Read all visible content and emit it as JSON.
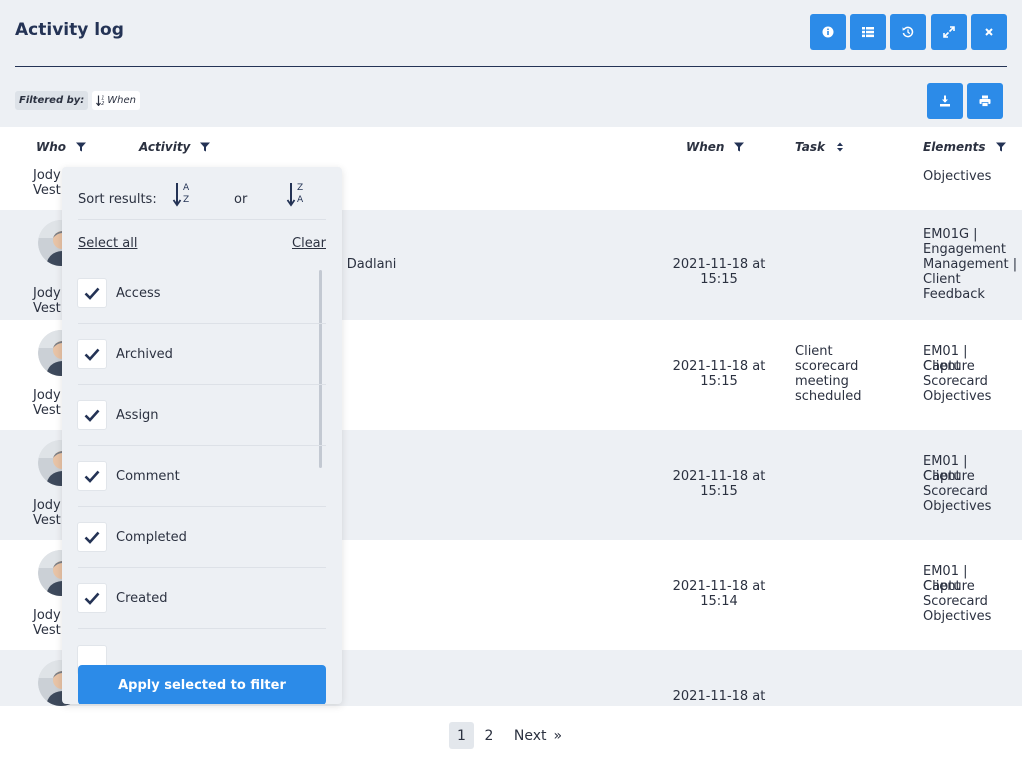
{
  "header": {
    "title": "Activity log",
    "toolbar_icons": [
      "info-icon",
      "list-icon",
      "history-icon",
      "expand-icon",
      "close-icon"
    ],
    "action_icons": [
      "download-icon",
      "print-icon"
    ]
  },
  "filter": {
    "label": "Filtered by:",
    "chip": "When"
  },
  "columns": {
    "who": "Who",
    "activity": "Activity",
    "when": "When",
    "task": "Task",
    "elements": "Elements"
  },
  "rows": [
    {
      "who1": "Jody",
      "who2": "Vest",
      "activity": "",
      "when1": "",
      "when2": "",
      "task": [],
      "elements": [
        "Objectives"
      ]
    },
    {
      "who1": "Jody",
      "who2": "Vest",
      "activity": "l Dadlani",
      "when1": "2021-11-18 at",
      "when2": "15:15",
      "task": [],
      "elements": [
        "EM01G |",
        "Engagement",
        "Management |",
        "Client",
        "Feedback"
      ]
    },
    {
      "who1": "Jody",
      "who2": "Vest",
      "activity": ".",
      "when1": "2021-11-18 at",
      "when2": "15:15",
      "task": [
        "Client",
        "scorecard",
        "meeting",
        "scheduled"
      ],
      "elements": [
        "EM01 | Capture",
        "Client",
        "Scorecard",
        "Objectives"
      ]
    },
    {
      "who1": "Jody",
      "who2": "Vest",
      "activity": "",
      "when1": "2021-11-18 at",
      "when2": "15:15",
      "task": [],
      "elements": [
        "EM01 | Capture",
        "Client",
        "Scorecard",
        "Objectives"
      ]
    },
    {
      "who1": "Jody",
      "who2": "Vest",
      "activity": "",
      "when1": "2021-11-18 at",
      "when2": "15:14",
      "task": [],
      "elements": [
        "EM01 | Capture",
        "Client",
        "Scorecard",
        "Objectives"
      ]
    },
    {
      "who1": "",
      "who2": "",
      "activity": "",
      "when1": "2021-11-18 at",
      "when2": "",
      "task": [],
      "elements": []
    }
  ],
  "dropdown": {
    "sort_label": "Sort results:",
    "or_label": "or",
    "select_all": "Select all",
    "clear": "Clear",
    "options": [
      {
        "label": "Access",
        "checked": true
      },
      {
        "label": "Archived",
        "checked": true
      },
      {
        "label": "Assign",
        "checked": true
      },
      {
        "label": "Comment",
        "checked": true
      },
      {
        "label": "Completed",
        "checked": true
      },
      {
        "label": "Created",
        "checked": true
      }
    ],
    "apply_label": "Apply selected to filter"
  },
  "pagination": {
    "pages": [
      "1",
      "2"
    ],
    "active": "1",
    "next": "Next",
    "next_arrow": "»"
  },
  "colors": {
    "accent": "#2c8be8",
    "title": "#243355",
    "text": "#2b3140",
    "bg": "#edf0f4"
  }
}
